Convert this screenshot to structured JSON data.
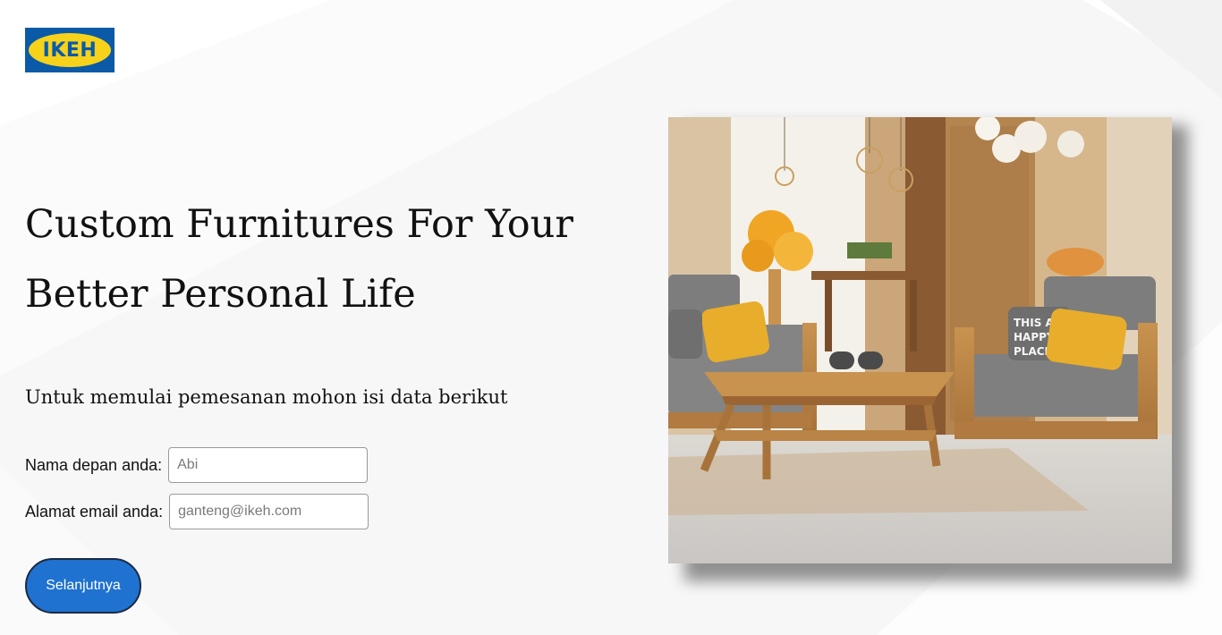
{
  "brand": {
    "logo_text": "IKEH",
    "colors": {
      "blue": "#0a5aa8",
      "yellow": "#f6d21b"
    }
  },
  "hero": {
    "headline_line1": "Custom Furnitures For Your",
    "headline_line2": "Better Personal Life"
  },
  "form": {
    "subtitle": "Untuk memulai pemesanan mohon isi data berikut",
    "first_name": {
      "label": "Nama depan anda:",
      "placeholder": "Abi",
      "value": ""
    },
    "email": {
      "label": "Alamat email anda:",
      "placeholder": "ganteng@ikeh.com",
      "value": ""
    },
    "next_button": "Selanjutnya"
  },
  "showcase": {
    "image_icon": "furniture-photo",
    "pillow_text": "THIS A HAPPY PLACE"
  },
  "accent_color": "#1f72cf"
}
